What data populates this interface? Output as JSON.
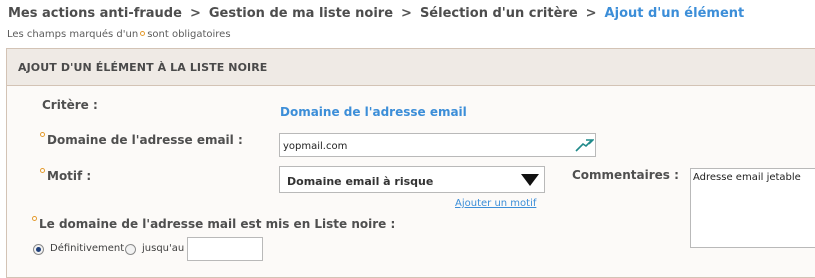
{
  "breadcrumb": {
    "items": [
      "Mes actions anti-fraude",
      "Gestion de ma liste noire",
      "Sélection d'un critère"
    ],
    "current": "Ajout d'un élément",
    "separator": ">"
  },
  "required_note": {
    "before": "Les champs marqués d'un",
    "after": "sont obligatoires"
  },
  "panel": {
    "title": "AJOUT D'UN ÉLÉMENT À LA LISTE NOIRE"
  },
  "form": {
    "critere_label": "Critère :",
    "critere_value": "Domaine de l'adresse email",
    "domaine_label": "Domaine de l'adresse email :",
    "domaine_value": "yopmail.com",
    "motif_label": "Motif :",
    "motif_value": "Domaine email à risque",
    "add_motif_link": "Ajouter un motif",
    "commentaires_label": "Commentaires :",
    "commentaires_value": "Adresse email jetable",
    "blacklist_question": "Le domaine de l'adresse mail est mis en Liste noire :",
    "option_permanent": "Définitivement",
    "option_until": "jusqu'au",
    "until_date_value": ""
  },
  "colors": {
    "accent": "#3c8ed8",
    "required_dot": "#e39a2d",
    "panel_border": "#d3c3b5",
    "panel_header_bg": "#efeae5"
  },
  "icons": {
    "email_field": "email-autocomplete-icon",
    "select_arrow": "triangle-down-icon"
  }
}
